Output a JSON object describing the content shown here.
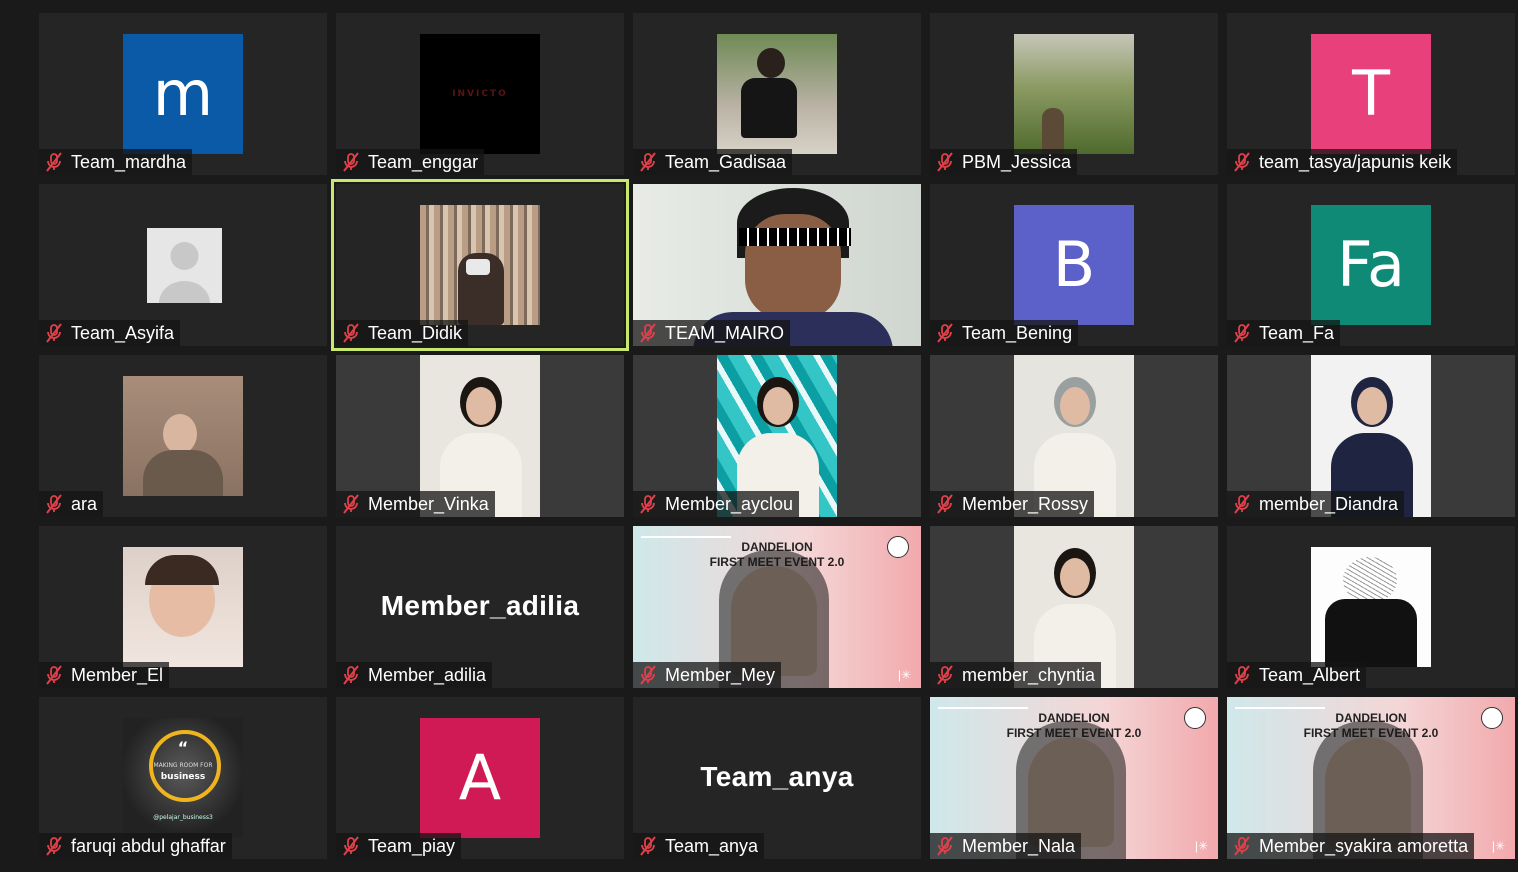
{
  "meeting": {
    "participants": [
      {
        "name": "Team_mardha",
        "avatar": "m",
        "avatar_color": "#0a5aa8",
        "kind": "letter"
      },
      {
        "name": "Team_enggar",
        "avatar_color": "#000000",
        "kind": "dark-logo",
        "logo_text": "INVICTO"
      },
      {
        "name": "Team_Gadisaa",
        "kind": "photo",
        "photo": "person-sitting-photo"
      },
      {
        "name": "PBM_Jessica",
        "kind": "photo",
        "photo": "field-landscape-photo"
      },
      {
        "name": "team_tasya/japunis keik",
        "avatar": "T",
        "avatar_color": "#e8407a",
        "kind": "letter"
      },
      {
        "name": "Team_Asyifa",
        "kind": "default-avatar"
      },
      {
        "name": "Team_Didik",
        "kind": "photo",
        "photo": "bookshelf-photo",
        "active": true
      },
      {
        "name": "TEAM_MAIRO",
        "kind": "video",
        "video": "webcam-sunglasses"
      },
      {
        "name": "Team_Bening",
        "avatar": "B",
        "avatar_color": "#5b61c8",
        "kind": "letter"
      },
      {
        "name": "Team_Fa",
        "avatar": "Fa",
        "avatar_color": "#0e8a76",
        "kind": "letter"
      },
      {
        "name": "ara",
        "kind": "photo",
        "photo": "portrait-photo"
      },
      {
        "name": "Member_Vinka",
        "kind": "video",
        "video": "portrait-webcam"
      },
      {
        "name": "Member_ayclou",
        "kind": "video",
        "video": "portrait-webcam-tiles"
      },
      {
        "name": "Member_Rossy",
        "kind": "video",
        "video": "portrait-webcam-hijab"
      },
      {
        "name": "member_Diandra",
        "kind": "video",
        "video": "portrait-webcam-hijab-dark"
      },
      {
        "name": "Member_El",
        "kind": "photo",
        "photo": "child-photo"
      },
      {
        "name": "Member_adilia",
        "big_label": "Member_adilia",
        "kind": "name-only"
      },
      {
        "name": "Member_Mey",
        "kind": "video",
        "video": "banner-webcam",
        "banner_lines": [
          "DANDELION",
          "FIRST MEET EVENT 2.0"
        ]
      },
      {
        "name": "member_chyntia",
        "kind": "video",
        "video": "portrait-webcam-girl"
      },
      {
        "name": "Team_Albert",
        "kind": "photo",
        "photo": "manga-photo"
      },
      {
        "name": "faruqi abdul ghaffar",
        "kind": "photo",
        "photo": "business-quote-photo",
        "photo_text": [
          "“",
          "MAKING ROOM FOR",
          "business",
          "@pelajar_business3"
        ]
      },
      {
        "name": "Team_piay",
        "avatar": "A",
        "avatar_color": "#d01a55",
        "kind": "letter"
      },
      {
        "name": "Team_anya",
        "big_label": "Team_anya",
        "kind": "name-only"
      },
      {
        "name": "Member_Nala",
        "kind": "video",
        "video": "banner-webcam",
        "banner_lines": [
          "DANDELION",
          "FIRST MEET EVENT 2.0"
        ]
      },
      {
        "name": "Member_syakira amoretta",
        "kind": "video",
        "video": "banner-webcam",
        "banner_lines": [
          "DANDELION",
          "FIRST MEET EVENT 2.0"
        ]
      }
    ],
    "muted_icon": "mic-muted-icon",
    "colors": {
      "background": "#1a1a1a",
      "tile": "#252525",
      "active_border": "#c9e870",
      "mute_red": "#e0404a"
    }
  }
}
